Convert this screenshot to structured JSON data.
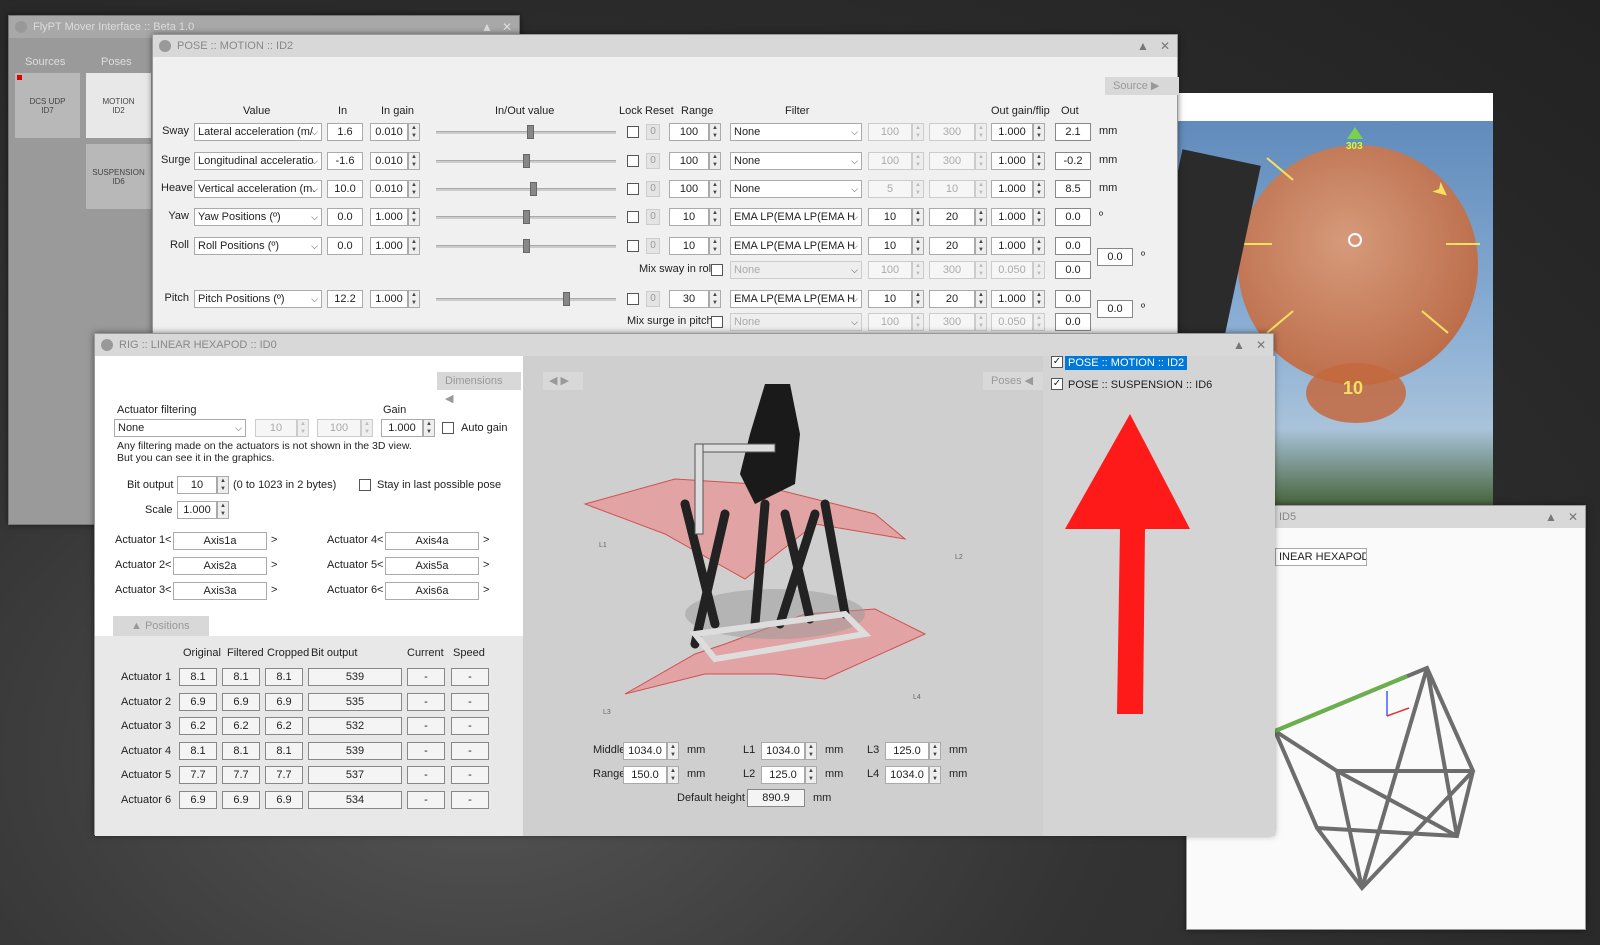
{
  "bg_win": {
    "title": "FlyPT Mover Interface :: Beta 1.0",
    "tabs": [
      "Sources",
      "Poses"
    ],
    "items": [
      "DCS UDP\nID7",
      "MOTION\nID2",
      "SUSPENSION\nID6"
    ]
  },
  "pose": {
    "title": "POSE :: MOTION :: ID2",
    "source_btn": "Source",
    "headers": {
      "value": "Value",
      "in": "In",
      "in_gain": "In gain",
      "inout": "In/Out value",
      "lock": "Lock",
      "reset": "Reset",
      "range": "Range",
      "filter": "Filter",
      "outgain": "Out gain/flip",
      "out": "Out"
    },
    "rows": [
      {
        "name": "Sway",
        "value": "Lateral acceleration (m/",
        "in": "1.6",
        "gain": "0.010",
        "lock": "0",
        "range": "100",
        "filter": "None",
        "f1": "100",
        "f2": "300",
        "outgain": "1.000",
        "out": "2.1",
        "unit": "mm",
        "slider": 0.52,
        "fdis": true
      },
      {
        "name": "Surge",
        "value": "Longitudinal acceleratio",
        "in": "-1.6",
        "gain": "0.010",
        "lock": "0",
        "range": "100",
        "filter": "None",
        "f1": "100",
        "f2": "300",
        "outgain": "1.000",
        "out": "-0.2",
        "unit": "mm",
        "slider": 0.5,
        "fdis": true
      },
      {
        "name": "Heave",
        "value": "Vertical acceleration (m.",
        "in": "10.0",
        "gain": "0.010",
        "lock": "0",
        "range": "100",
        "filter": "None",
        "f1": "5",
        "f2": "10",
        "outgain": "1.000",
        "out": "8.5",
        "unit": "mm",
        "slider": 0.54,
        "fdis": true
      },
      {
        "name": "Yaw",
        "value": "Yaw Positions (º)",
        "in": "0.0",
        "gain": "1.000",
        "lock": "0",
        "range": "10",
        "filter": "EMA LP(EMA LP(EMA H",
        "f1": "10",
        "f2": "20",
        "outgain": "1.000",
        "out": "0.0",
        "unit": "º",
        "slider": 0.5,
        "fdis": false
      },
      {
        "name": "Roll",
        "value": "Roll Positions (º)",
        "in": "0.0",
        "gain": "1.000",
        "lock": "0",
        "range": "10",
        "filter": "EMA LP(EMA LP(EMA H",
        "f1": "10",
        "f2": "20",
        "outgain": "1.000",
        "out": "0.0",
        "unit": "",
        "slider": 0.5,
        "fdis": false
      }
    ],
    "mix_roll": {
      "label": "Mix sway in roll",
      "filter": "None",
      "f1": "100",
      "f2": "300",
      "gain": "0.050",
      "out": "0.0",
      "total": "0.0",
      "unit": "º"
    },
    "pitch": {
      "name": "Pitch",
      "value": "Pitch Positions (º)",
      "in": "12.2",
      "gain": "1.000",
      "lock": "0",
      "range": "30",
      "filter": "EMA LP(EMA LP(EMA H",
      "f1": "10",
      "f2": "20",
      "outgain": "1.000",
      "out": "0.0",
      "slider": 0.72
    },
    "mix_pitch": {
      "label": "Mix surge in pitch",
      "filter": "None",
      "f1": "100",
      "f2": "300",
      "gain": "0.050",
      "out": "0.0",
      "total": "0.0",
      "unit": "º"
    }
  },
  "rig": {
    "title": "RIG :: LINEAR HEXAPOD :: ID0",
    "dims_tab": "Dimensions",
    "poses_tab": "Poses",
    "act_filter_label": "Actuator filtering",
    "gain_label": "Gain",
    "filter": "None",
    "f1": "10",
    "f2": "100",
    "gain": "1.000",
    "auto_gain": "Auto gain",
    "note1": "Any filtering made on the actuators is not shown in the 3D view.",
    "note2": "But you can see it in the graphics.",
    "bit_label": "Bit output",
    "bit": "10",
    "bit_note": "(0 to 1023 in 2 bytes)",
    "stay": "Stay in last possible pose",
    "scale_label": "Scale",
    "scale": "1.000",
    "actuators": [
      {
        "l": "Actuator 1",
        "v": "Axis1a"
      },
      {
        "l": "Actuator 2",
        "v": "Axis2a"
      },
      {
        "l": "Actuator 3",
        "v": "Axis3a"
      },
      {
        "l": "Actuator 4",
        "v": "Axis4a"
      },
      {
        "l": "Actuator 5",
        "v": "Axis5a"
      },
      {
        "l": "Actuator 6",
        "v": "Axis6a"
      }
    ],
    "positions_tab": "Positions",
    "pos_headers": [
      "Original",
      "Filtered",
      "Cropped",
      "Bit output",
      "Current",
      "Speed"
    ],
    "positions": [
      {
        "n": "Actuator 1",
        "o": "8.1",
        "f": "8.1",
        "c": "8.1",
        "b": "539",
        "cur": "-",
        "sp": "-"
      },
      {
        "n": "Actuator 2",
        "o": "6.9",
        "f": "6.9",
        "c": "6.9",
        "b": "535",
        "cur": "-",
        "sp": "-"
      },
      {
        "n": "Actuator 3",
        "o": "6.2",
        "f": "6.2",
        "c": "6.2",
        "b": "532",
        "cur": "-",
        "sp": "-"
      },
      {
        "n": "Actuator 4",
        "o": "8.1",
        "f": "8.1",
        "c": "8.1",
        "b": "539",
        "cur": "-",
        "sp": "-"
      },
      {
        "n": "Actuator 5",
        "o": "7.7",
        "f": "7.7",
        "c": "7.7",
        "b": "537",
        "cur": "-",
        "sp": "-"
      },
      {
        "n": "Actuator 6",
        "o": "6.9",
        "f": "6.9",
        "c": "6.9",
        "b": "534",
        "cur": "-",
        "sp": "-"
      }
    ],
    "dims": {
      "middle_l": "Middle",
      "middle": "1034.0",
      "range_l": "Range",
      "range": "150.0",
      "l1_l": "L1",
      "l1": "1034.0",
      "l2_l": "L2",
      "l2": "125.0",
      "l3_l": "L3",
      "l3": "125.0",
      "l4_l": "L4",
      "l4": "1034.0",
      "unit": "mm",
      "dh_l": "Default height",
      "dh": "890.9"
    },
    "vp_labels": {
      "L1": "L1",
      "L2": "L2",
      "L3": "L3",
      "L4": "L4"
    },
    "pose_list": [
      {
        "label": "POSE :: MOTION :: ID2",
        "selected": true
      },
      {
        "label": "POSE :: SUSPENSION :: ID6",
        "selected": false
      }
    ]
  },
  "hud": {
    "heading": "303",
    "pitch": "10"
  },
  "side": {
    "title": "ID5",
    "combo": "INEAR HEXAPOD"
  },
  "colors": {
    "arrow": "#ff1a1a",
    "select": "#0078d7",
    "green": "#6ab04c"
  }
}
